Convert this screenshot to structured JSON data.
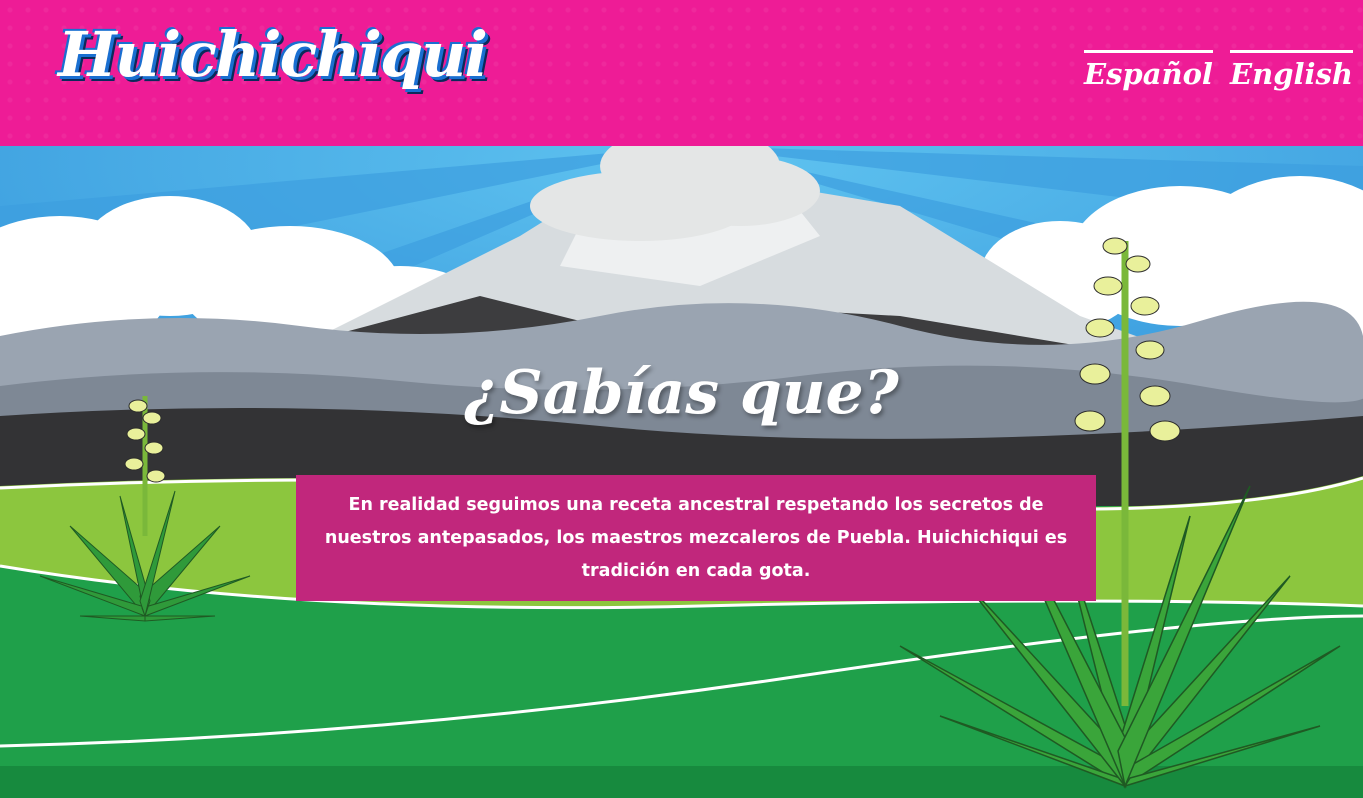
{
  "header": {
    "logo_text": "Huichichiqui",
    "languages": [
      {
        "label": "Español"
      },
      {
        "label": "English"
      }
    ],
    "bg_color": "#ee1c96"
  },
  "hero": {
    "title": "¿Sabías que?",
    "body": "En realidad seguimos una receta ancestral respetando los secretos de nuestros antepasados, los maestros mezcaleros de Puebla. Huichichiqui es tradición en cada gota.",
    "box_color": "#c1277c"
  },
  "illustration": {
    "subject": "volcano-with-agave-landscape"
  }
}
